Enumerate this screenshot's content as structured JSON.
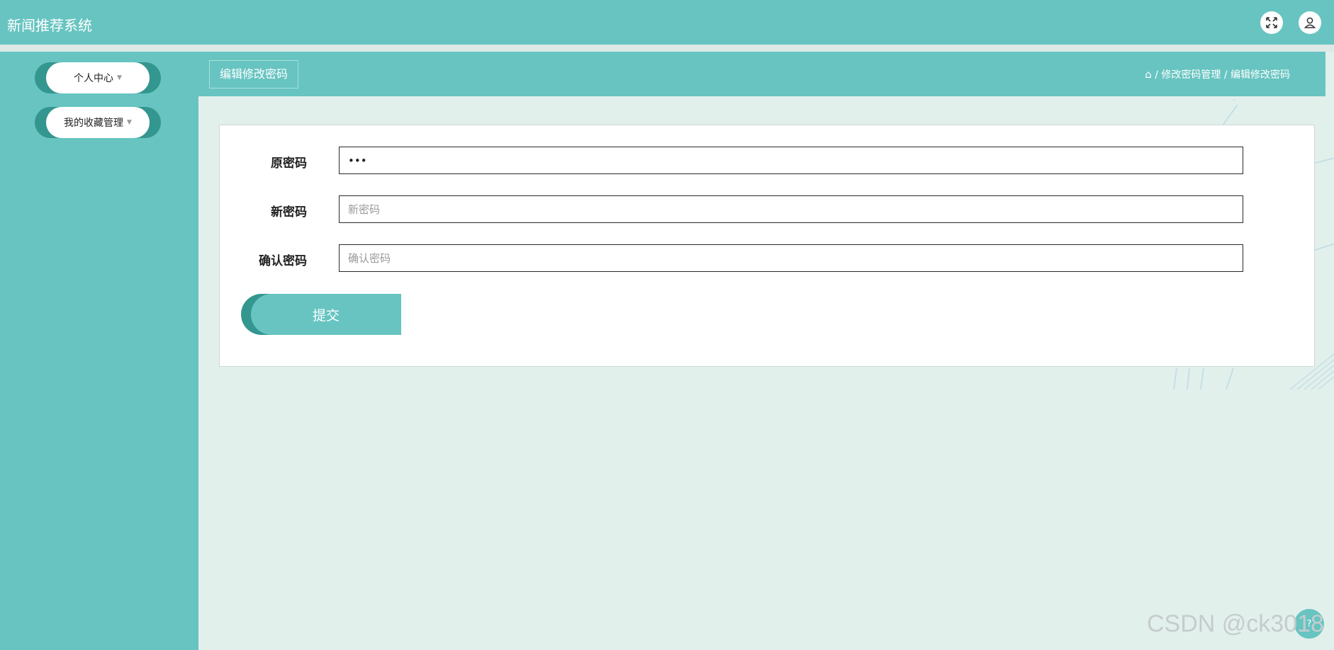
{
  "app": {
    "title": "新闻推荐系统"
  },
  "header": {
    "fullscreen_icon": "fullscreen-expand-icon",
    "user_icon": "user-icon"
  },
  "sidebar": {
    "items": [
      {
        "label": "个人中心",
        "caret": "▼"
      },
      {
        "label": "我的收藏管理",
        "caret": "▼"
      }
    ]
  },
  "page": {
    "title": "编辑修改密码",
    "breadcrumb": {
      "home_icon": "⌂",
      "separator": "/",
      "level1": "修改密码管理",
      "level2": "编辑修改密码"
    }
  },
  "form": {
    "old_password": {
      "label": "原密码",
      "value": "•••"
    },
    "new_password": {
      "label": "新密码",
      "placeholder": "新密码",
      "value": ""
    },
    "confirm_password": {
      "label": "确认密码",
      "placeholder": "确认密码",
      "value": ""
    },
    "submit_label": "提交"
  },
  "watermark": "CSDN @ck3018",
  "colors": {
    "primary": "#67c4c1",
    "primary_dark": "#33968f",
    "content_bg": "#e2f0ec"
  }
}
